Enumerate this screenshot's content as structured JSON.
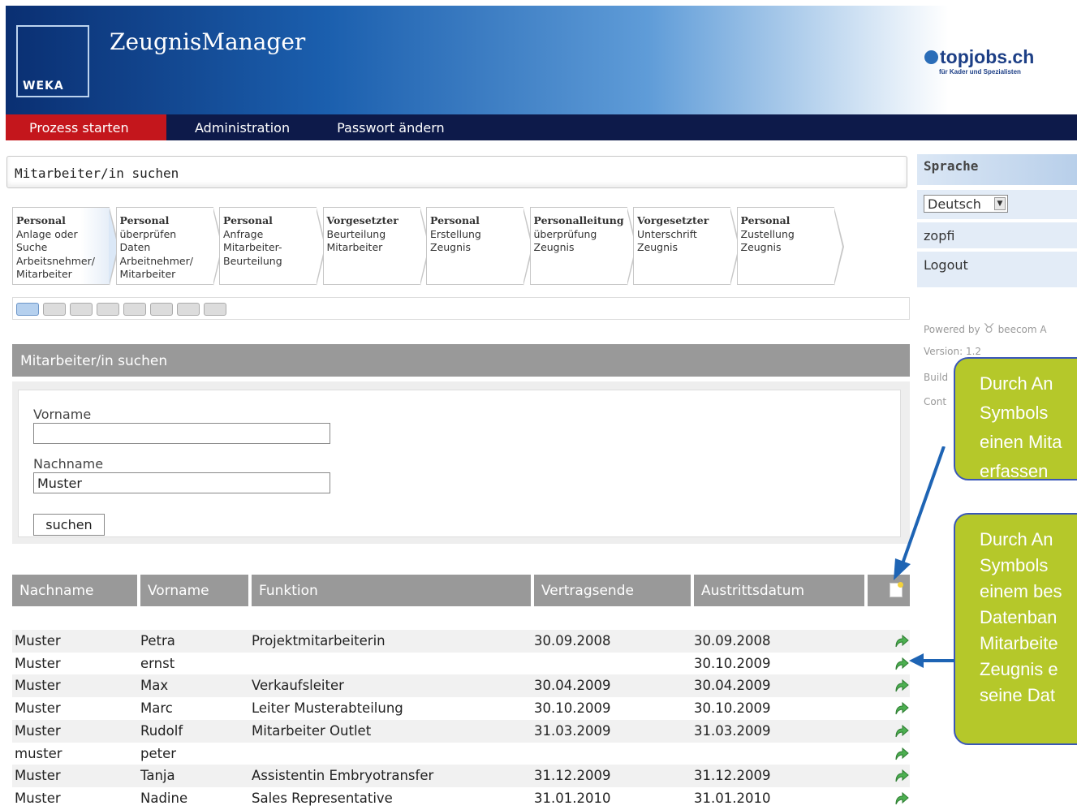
{
  "header": {
    "brand": "WEKA",
    "title": "ZeugnisManager",
    "partner_name": "topjobs.ch",
    "partner_tagline": "für Kader und Spezialisten"
  },
  "nav": {
    "items": [
      {
        "label": "Prozess starten"
      },
      {
        "label": "Administration"
      },
      {
        "label": "Passwort ändern"
      }
    ]
  },
  "page_title": "Mitarbeiter/in suchen",
  "steps": [
    {
      "role": "Personal",
      "text": [
        "Anlage oder",
        "Suche",
        "Arbeitsnehmer/",
        "Mitarbeiter"
      ]
    },
    {
      "role": "Personal",
      "text": [
        "überprüfen",
        "Daten",
        "Arbeitnehmer/",
        "Mitarbeiter"
      ]
    },
    {
      "role": "Personal",
      "text": [
        "Anfrage",
        "Mitarbeiter-",
        "Beurteilung"
      ]
    },
    {
      "role": "Vorgesetzter",
      "text": [
        "Beurteilung",
        "Mitarbeiter"
      ]
    },
    {
      "role": "Personal",
      "text": [
        "Erstellung",
        "Zeugnis"
      ]
    },
    {
      "role": "Personalleitung",
      "text": [
        "überprüfung",
        "Zeugnis"
      ]
    },
    {
      "role": "Vorgesetzter",
      "text": [
        "Unterschrift",
        "Zeugnis"
      ]
    },
    {
      "role": "Personal",
      "text": [
        "Zustellung",
        "Zeugnis"
      ]
    }
  ],
  "progress": {
    "current_step": 1,
    "total_steps": 8
  },
  "search": {
    "heading": "Mitarbeiter/in suchen",
    "firstname_label": "Vorname",
    "firstname_value": "",
    "lastname_label": "Nachname",
    "lastname_value": "Muster",
    "button_label": "suchen"
  },
  "table": {
    "columns": [
      "Nachname",
      "Vorname",
      "Funktion",
      "Vertragsende",
      "Austrittsdatum"
    ],
    "rows": [
      {
        "nachname": "Muster",
        "vorname": "Petra",
        "funktion": "Projektmitarbeiterin",
        "vertragsende": "30.09.2008",
        "austritt": "30.09.2008"
      },
      {
        "nachname": "Muster",
        "vorname": "ernst",
        "funktion": "",
        "vertragsende": "",
        "austritt": "30.10.2009"
      },
      {
        "nachname": "Muster",
        "vorname": "Max",
        "funktion": "Verkaufsleiter",
        "vertragsende": "30.04.2009",
        "austritt": "30.04.2009"
      },
      {
        "nachname": "Muster",
        "vorname": "Marc",
        "funktion": "Leiter Musterabteilung",
        "vertragsende": "30.10.2009",
        "austritt": "30.10.2009"
      },
      {
        "nachname": "Muster",
        "vorname": "Rudolf",
        "funktion": "Mitarbeiter Outlet",
        "vertragsende": "31.03.2009",
        "austritt": "31.03.2009"
      },
      {
        "nachname": "muster",
        "vorname": "peter",
        "funktion": "",
        "vertragsende": "",
        "austritt": ""
      },
      {
        "nachname": "Muster",
        "vorname": "Tanja",
        "funktion": "Assistentin Embryotransfer",
        "vertragsende": "31.12.2009",
        "austritt": "31.12.2009"
      },
      {
        "nachname": "Muster",
        "vorname": "Nadine",
        "funktion": "Sales Representative",
        "vertragsende": "31.01.2010",
        "austritt": "31.01.2010"
      }
    ]
  },
  "sidebar": {
    "language_heading": "Sprache",
    "language_value": "Deutsch",
    "user": "zopfi",
    "logout": "Logout",
    "powered_by": "Powered by",
    "powered_company": "beecom A",
    "version": "Version: 1.2",
    "build": "Build",
    "contact": "Cont"
  },
  "callouts": [
    {
      "lines": [
        "Durch An",
        "Symbols",
        "einen Mita",
        "erfassen"
      ]
    },
    {
      "lines": [
        "Durch An",
        "Symbols",
        "einem bes",
        "Datenban",
        "Mitarbeite",
        "Zeugnis e",
        "seine Dat"
      ]
    }
  ],
  "colors": {
    "nav_bg": "#0d1a4a",
    "nav_active": "#c4161c",
    "table_header": "#999999",
    "callout_fill": "#b5c82a",
    "callout_border": "#3a57b8",
    "arrow": "#1e64b4"
  }
}
